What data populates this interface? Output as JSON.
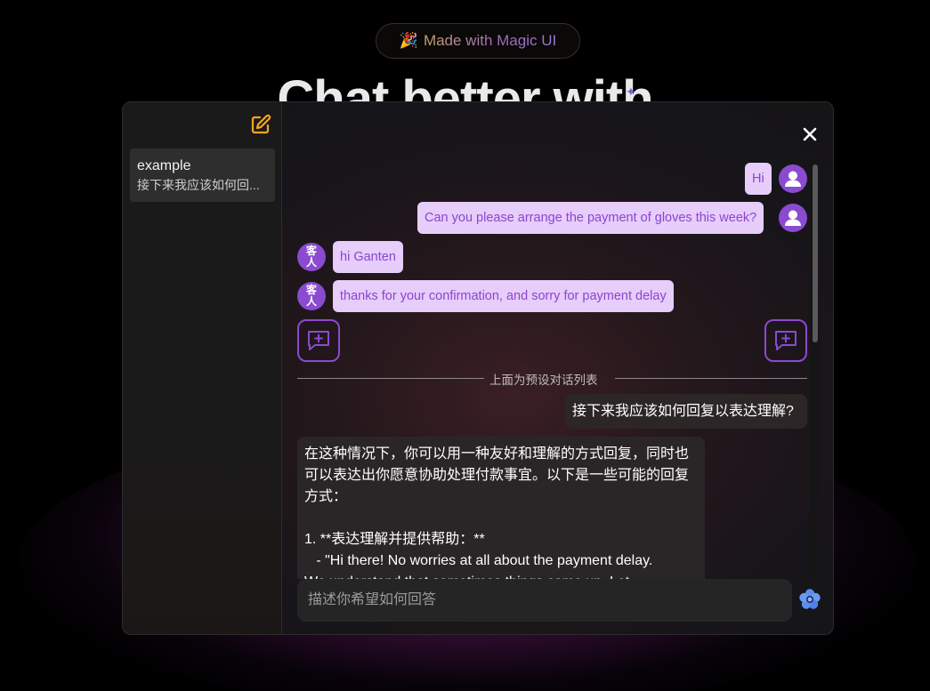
{
  "badge": {
    "emoji": "🎉",
    "text": "Made with Magic UI"
  },
  "hero": {
    "title": "Chat better with"
  },
  "sidebar": {
    "conversations": [
      {
        "title": "example",
        "preview": "接下来我应该如何回..."
      }
    ]
  },
  "messages": [
    {
      "role": "user",
      "text": "Hi"
    },
    {
      "role": "user",
      "text": "Can you please arrange the payment of gloves this week?"
    },
    {
      "role": "guest",
      "avatar_label_top": "客",
      "avatar_label_bottom": "人",
      "text": "hi Ganten"
    },
    {
      "role": "guest",
      "avatar_label_top": "客",
      "avatar_label_bottom": "人",
      "text": "thanks for your confirmation, and sorry for payment delay"
    }
  ],
  "divider": {
    "text": "上面为预设对话列表"
  },
  "question": {
    "text": "接下来我应该如何回复以表达理解?"
  },
  "answer": {
    "lines": [
      "在这种情况下，你可以用一种友好和理解的方式回复，同时也",
      "可以表达出你愿意协助处理付款事宜。以下是一些可能的回复",
      "方式：",
      "",
      "1. **表达理解并提供帮助：**",
      "   - \"Hi there! No worries at all about the payment delay.",
      "We understand that sometimes things come up. Let"
    ]
  },
  "input": {
    "placeholder": "描述你希望如何回答"
  },
  "colors": {
    "accent": "#8a4bd0",
    "bubble": "#e6cdfa",
    "edit_icon": "#f5a524",
    "send_icon": "#5b8ef0"
  }
}
